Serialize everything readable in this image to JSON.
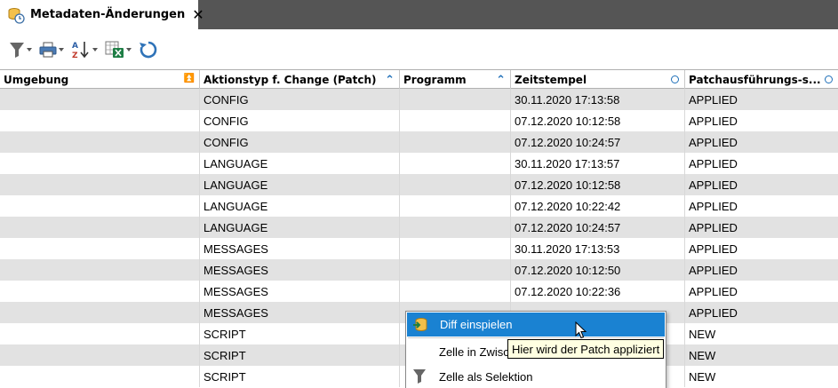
{
  "tab": {
    "title": "Metadaten-Änderungen",
    "close_glyph": "✕",
    "icon": "database-history-icon"
  },
  "toolbar": {
    "buttons": [
      {
        "icon": "filter-icon",
        "has_menu": true
      },
      {
        "icon": "print-icon",
        "has_menu": true
      },
      {
        "icon": "sort-az-icon",
        "has_menu": true
      },
      {
        "icon": "excel-export-icon",
        "has_menu": true
      },
      {
        "icon": "refresh-icon",
        "has_menu": false
      }
    ]
  },
  "table": {
    "columns": [
      {
        "label": "Umgebung",
        "indicator": "double-up"
      },
      {
        "label": "Aktionstyp f. Change (Patch)",
        "indicator": "up"
      },
      {
        "label": "Programm",
        "indicator": "up"
      },
      {
        "label": "Zeitstempel",
        "indicator": "circle"
      },
      {
        "label": "Patchausführungs-s...",
        "indicator": "circle"
      }
    ],
    "rows": [
      [
        "",
        "CONFIG",
        "",
        "30.11.2020 17:13:58",
        "APPLIED"
      ],
      [
        "",
        "CONFIG",
        "",
        "07.12.2020 10:12:58",
        "APPLIED"
      ],
      [
        "",
        "CONFIG",
        "",
        "07.12.2020 10:24:57",
        "APPLIED"
      ],
      [
        "",
        "LANGUAGE",
        "",
        "30.11.2020 17:13:57",
        "APPLIED"
      ],
      [
        "",
        "LANGUAGE",
        "",
        "07.12.2020 10:12:58",
        "APPLIED"
      ],
      [
        "",
        "LANGUAGE",
        "",
        "07.12.2020 10:22:42",
        "APPLIED"
      ],
      [
        "",
        "LANGUAGE",
        "",
        "07.12.2020 10:24:57",
        "APPLIED"
      ],
      [
        "",
        "MESSAGES",
        "",
        "30.11.2020 17:13:53",
        "APPLIED"
      ],
      [
        "",
        "MESSAGES",
        "",
        "07.12.2020 10:12:50",
        "APPLIED"
      ],
      [
        "",
        "MESSAGES",
        "",
        "07.12.2020 10:22:36",
        "APPLIED"
      ],
      [
        "",
        "MESSAGES",
        "",
        "",
        "APPLIED"
      ],
      [
        "",
        "SCRIPT",
        "",
        "",
        "NEW"
      ],
      [
        "",
        "SCRIPT",
        "",
        "",
        "NEW"
      ],
      [
        "",
        "SCRIPT",
        "",
        "",
        "NEW"
      ]
    ]
  },
  "context_menu": {
    "items": [
      {
        "label": "Diff einspielen",
        "icon": "diff-apply-icon",
        "active": true
      },
      {
        "label": "Zelle in Zwisc",
        "icon": "",
        "active": false
      },
      {
        "label": "Zelle als Selektion",
        "icon": "filter-icon",
        "active": false
      }
    ]
  },
  "tooltip": {
    "text": "Hier wird der Patch appliziert"
  },
  "colors": {
    "tab_bar": "#555555",
    "row_alt": "#e2e2e2",
    "menu_highlight": "#1a82d2",
    "sort_indicator": "#1e6fb8",
    "tooltip_bg": "#ffffe1"
  }
}
